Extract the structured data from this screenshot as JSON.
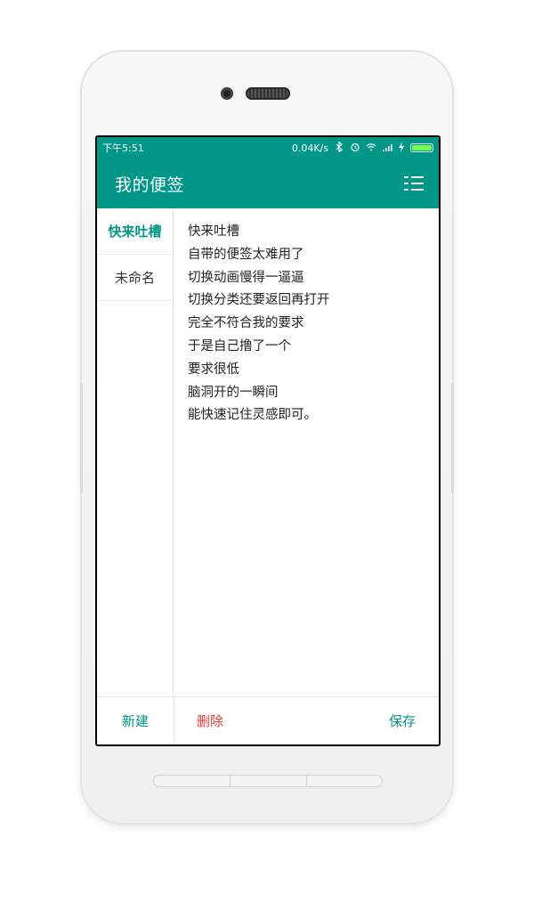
{
  "statusbar": {
    "time": "下午5:51",
    "network_speed": "0.04K/s",
    "icons": [
      "bluetooth-icon",
      "alarm-icon",
      "wifi-icon",
      "signal-icon",
      "charging-icon",
      "battery-icon"
    ]
  },
  "appbar": {
    "title": "我的便签",
    "menu_icon": "list-menu-icon"
  },
  "sidebar": {
    "items": [
      {
        "label": "快来吐槽",
        "active": true
      },
      {
        "label": "未命名",
        "active": false
      }
    ]
  },
  "note": {
    "lines": [
      "快来吐槽",
      "自带的便签太难用了",
      "切换动画慢得一逼逼",
      "切换分类还要返回再打开",
      "完全不符合我的要求",
      "于是自己撸了一个",
      "要求很低",
      "脑洞开的一瞬间",
      "能快速记住灵感即可。"
    ]
  },
  "bottom": {
    "new_label": "新建",
    "delete_label": "删除",
    "save_label": "保存"
  },
  "colors": {
    "primary": "#009688",
    "delete": "#e53935"
  }
}
